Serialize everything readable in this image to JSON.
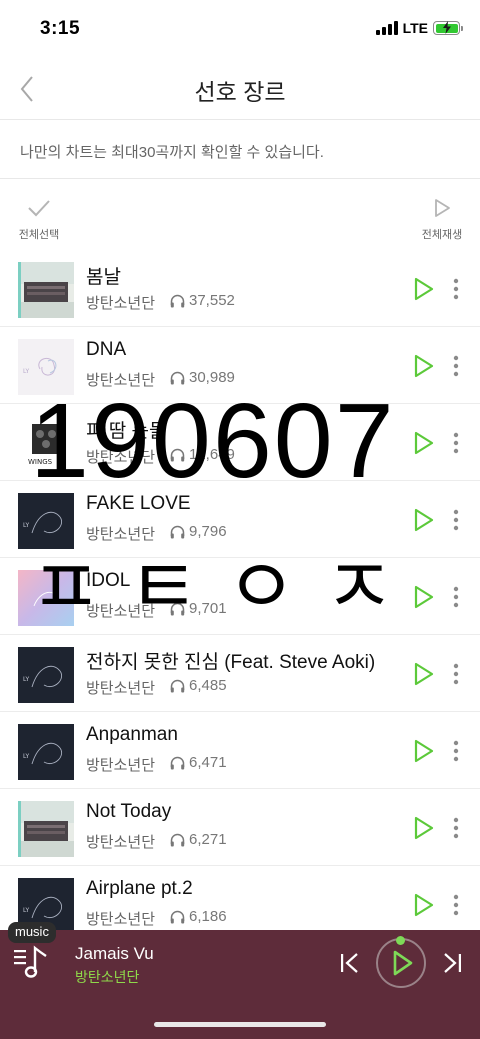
{
  "status_bar": {
    "time": "3:15",
    "network": "LTE"
  },
  "header": {
    "title": "선호 장르",
    "back_icon": "chevron-left-icon"
  },
  "notice": "나만의 차트는 최대30곡까지 확인할 수 있습니다.",
  "actions": {
    "select_all": "전체선택",
    "play_all": "전체재생"
  },
  "songs": [
    {
      "title": "봄날",
      "artist": "방탄소년단",
      "plays": "37,552",
      "art": "you-never-walk-alone"
    },
    {
      "title": "DNA",
      "artist": "방탄소년단",
      "plays": "30,989",
      "art": "love-yourself-her"
    },
    {
      "title": "피 땀 눈물",
      "artist": "방탄소년단",
      "plays": "12,649",
      "art": "wings"
    },
    {
      "title": "FAKE LOVE",
      "artist": "방탄소년단",
      "plays": "9,796",
      "art": "love-yourself-tear"
    },
    {
      "title": "IDOL",
      "artist": "방탄소년단",
      "plays": "9,701",
      "art": "love-yourself-answer"
    },
    {
      "title": "전하지 못한 진심 (Feat. Steve Aoki)",
      "artist": "방탄소년단",
      "plays": "6,485",
      "art": "love-yourself-tear"
    },
    {
      "title": "Anpanman",
      "artist": "방탄소년단",
      "plays": "6,471",
      "art": "love-yourself-tear"
    },
    {
      "title": "Not Today",
      "artist": "방탄소년단",
      "plays": "6,271",
      "art": "you-never-walk-alone"
    },
    {
      "title": "Airplane pt.2",
      "artist": "방탄소년단",
      "plays": "6,186",
      "art": "love-yourself-tear"
    }
  ],
  "overlay": {
    "date": "190607",
    "jamo": "ㅍㅌㅇㅈ"
  },
  "mini_player": {
    "tag": "music",
    "title": "Jamais Vu",
    "artist": "방탄소년단"
  },
  "colors": {
    "accent_green": "#5cc93a",
    "player_background": "#5e2c3a",
    "artist_green": "#8fd94a"
  }
}
